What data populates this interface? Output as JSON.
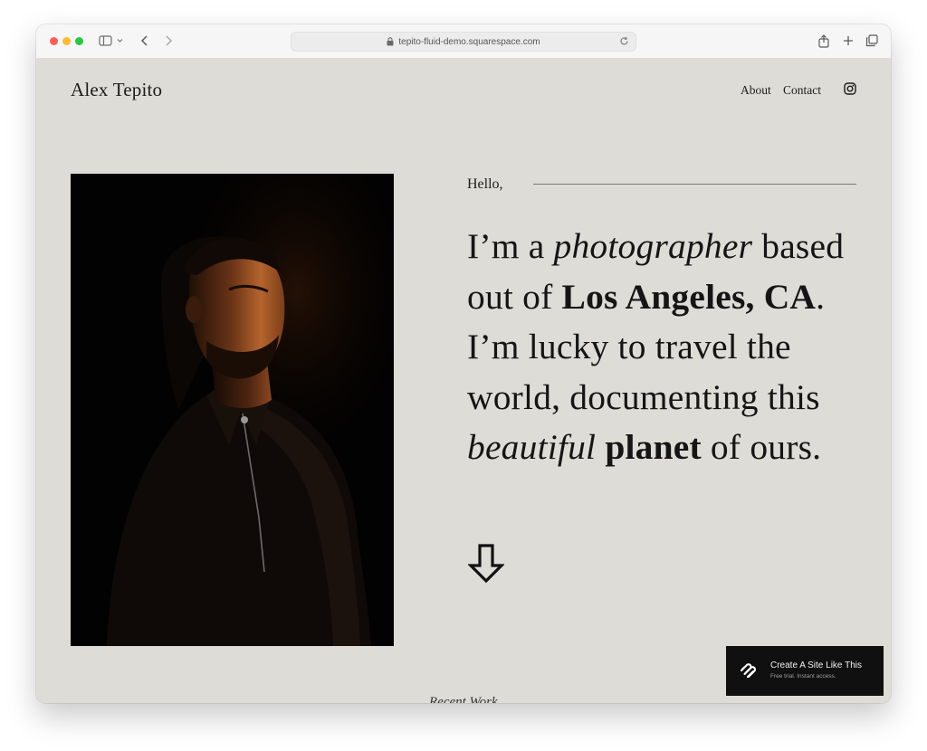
{
  "browser": {
    "url": "tepito-fluid-demo.squarespace.com",
    "icons": {
      "sidebar": "sidebar-icon",
      "back": "chevron-left-icon",
      "forward": "chevron-right-icon",
      "lock": "lock-icon",
      "reload": "reload-icon",
      "share": "share-icon",
      "new_tab": "plus-icon",
      "tabs": "tabs-overview-icon"
    }
  },
  "site": {
    "title": "Alex Tepito",
    "nav": [
      {
        "label": "About"
      },
      {
        "label": "Contact"
      }
    ],
    "social_icon": "instagram-icon"
  },
  "hero": {
    "greeting": "Hello,",
    "intro": {
      "p1": "I’m a ",
      "em1": "photographer",
      "p2": " based out of ",
      "b1": "Los Angeles, CA",
      "p3": ". I’m lucky to travel the world, documenting this ",
      "em2": "beautiful",
      "p4": " ",
      "b2": "planet",
      "p5": " of ours."
    },
    "scroll_icon": "arrow-down-icon"
  },
  "cta": {
    "title": "Create A Site Like This",
    "subtitle": "Free trial. Instant access.",
    "logo_icon": "squarespace-logo-icon"
  },
  "next_section": {
    "label": "Recent Work"
  },
  "colors": {
    "page_bg": "#dddcd6",
    "text": "#151515",
    "cta_bg": "#101010",
    "rule": "#7a7a76"
  }
}
